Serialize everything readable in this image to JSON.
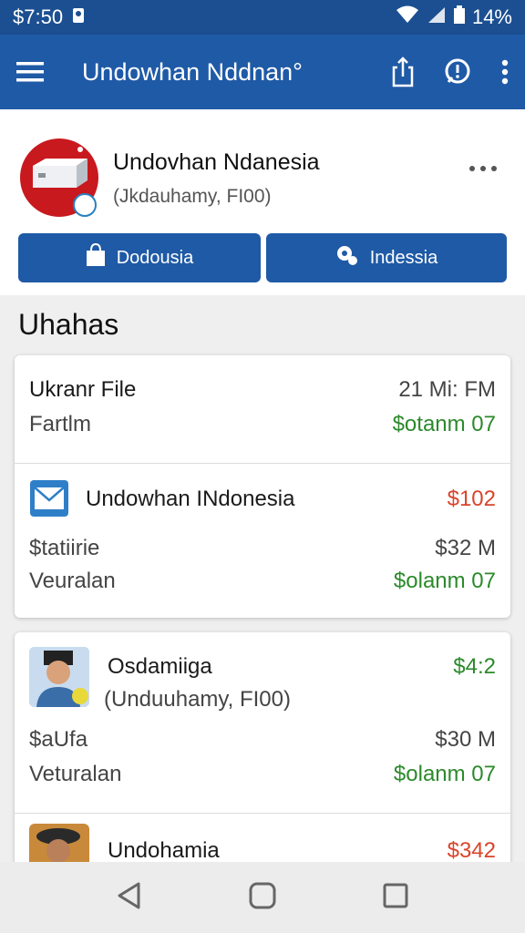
{
  "status_bar": {
    "time": "$7:50",
    "battery": "14%"
  },
  "app_bar": {
    "title": "Undowhan Nddnan°"
  },
  "profile": {
    "name": "Undovhan Ndanesia",
    "subtitle": "(Jkdauhamy, FI00)",
    "button_left": "Dodousia",
    "button_right": "Indessia"
  },
  "section": {
    "title": "Uhahas"
  },
  "card1": {
    "row1": {
      "title": "Ukranr File",
      "time": "21 Mi: FM"
    },
    "row2": {
      "label": "Fartlm",
      "amount": "$otanm 07"
    },
    "row3": {
      "title": "Undowhan INdonesia",
      "amount": "$102"
    },
    "row4": {
      "label": "$tatiirie",
      "amount": "$32 M"
    },
    "row5": {
      "label": "Veuralan",
      "amount": "$olanm 07"
    }
  },
  "card2": {
    "row1": {
      "title": "Osdamiiga",
      "amount": "$4:2"
    },
    "row2": {
      "label": "(Unduuhamy, FI00)"
    },
    "row3": {
      "label": "$aUfa",
      "amount": "$30 M"
    },
    "row4": {
      "label": "Veturalan",
      "amount": "$olanm 07"
    },
    "row5": {
      "title": "Undohamia",
      "amount": "$342"
    }
  },
  "colors": {
    "primary": "#1f5aa6",
    "status": "#1b4f91",
    "positive": "#2b8a2b",
    "negative": "#d9442a"
  }
}
